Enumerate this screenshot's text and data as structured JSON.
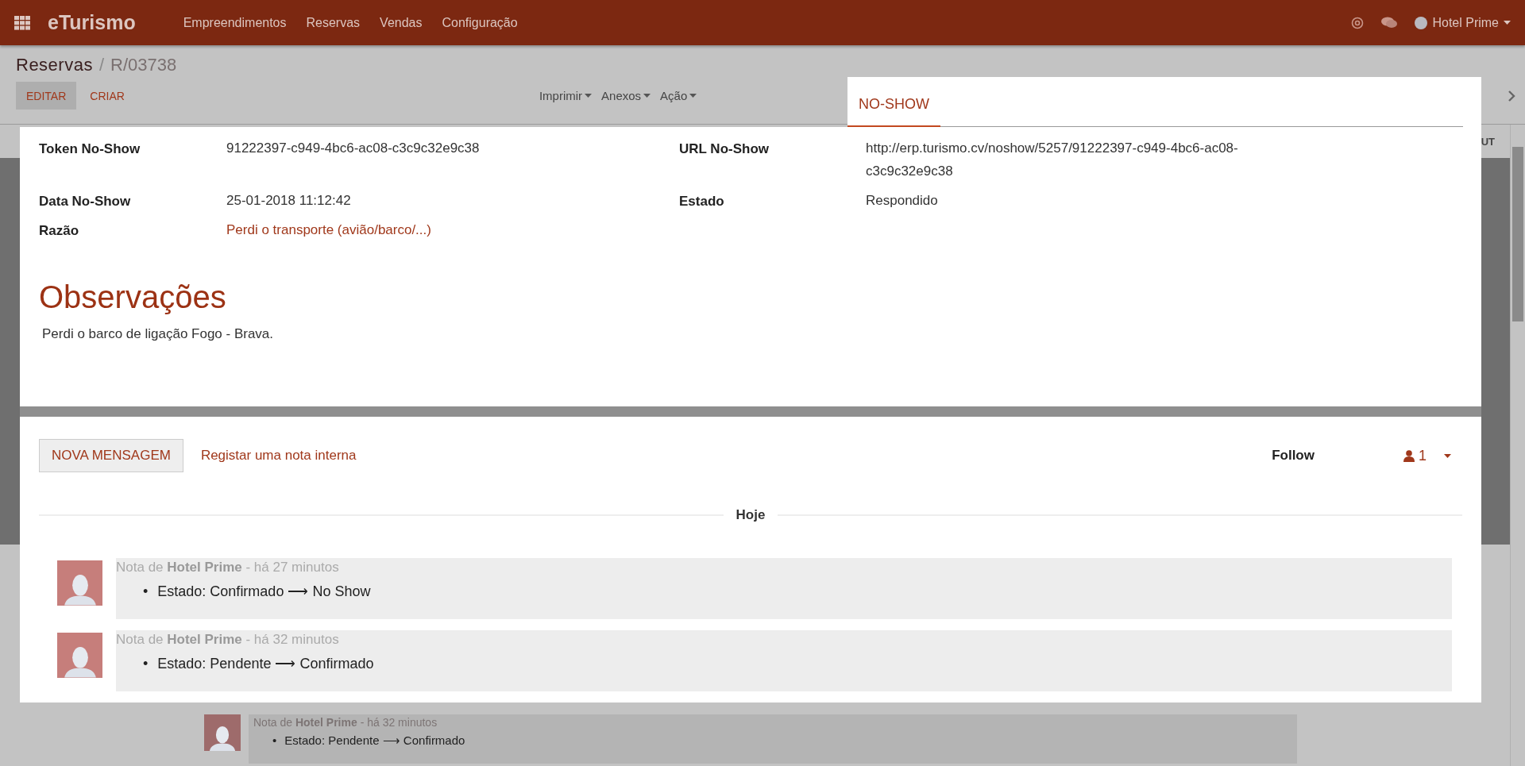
{
  "navbar": {
    "app_name": "eTurismo",
    "menu": [
      "Empreendimentos",
      "Reservas",
      "Vendas",
      "Configuração"
    ],
    "user": "Hotel Prime"
  },
  "breadcrumb": {
    "parent": "Reservas",
    "separator": "/",
    "current": "R/03738"
  },
  "buttons": [
    {
      "label": "EDITAR",
      "kind": "primary"
    },
    {
      "label": "CRIAR",
      "kind": "link"
    }
  ],
  "dropdowns": [
    "Imprimir",
    "Anexos",
    "Ação"
  ],
  "background_button_fragment": "UT",
  "background_message": {
    "header": "Nota de **Hotel Prime** - há 32 minutos",
    "bullet": "•",
    "change": "Estado: Pendente ⟶ Confirmado"
  },
  "overlay": {
    "tabs": [
      {
        "label": "NO-SHOW",
        "selected": true
      }
    ],
    "fields": [
      {
        "label": "Token No-Show",
        "value": "91222397-c949-4bc6-ac08-c3c9c32e9c38",
        "kind": "text"
      },
      {
        "label": "URL No-Show",
        "value": "http://erp.turismo.cv/noshow/5257/91222397-c949-4bc6-ac08-c3c9c32e9c38",
        "kind": "text"
      },
      {
        "label": "Data No-Show",
        "value": "25-01-2018 11:12:42",
        "kind": "text"
      },
      {
        "label": "Estado",
        "value": "Respondido",
        "kind": "text"
      },
      {
        "label": "Razão",
        "value": "Perdi o transporte (avião/barco/...)",
        "kind": "link"
      }
    ],
    "notes_title": "Observações",
    "notes": "Perdi o barco de ligação Fogo - Brava.",
    "chatter": {
      "new_message": "NOVA MENSAGEM",
      "log_note": "Registar uma nota interna",
      "follow": "Follow",
      "followers": "1",
      "date": "Hoje",
      "messages": [
        {
          "header": "Nota de **Hotel Prime** - há 27 minutos",
          "bullet": "•",
          "change": "Estado: Confirmado ⟶ No Show"
        },
        {
          "header": "Nota de **Hotel Prime** - há 32 minutos",
          "bullet": "•",
          "change": "Estado: Pendente ⟶ Confirmado"
        }
      ]
    }
  }
}
